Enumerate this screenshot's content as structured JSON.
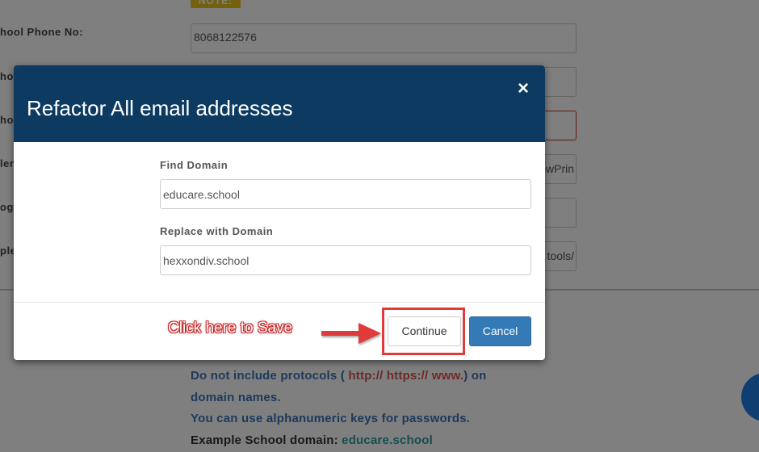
{
  "background": {
    "note_badge": "NOTE:",
    "labels": [
      "hool Phone No:",
      "ho",
      "ho",
      "len",
      "og",
      "ple"
    ],
    "phone_value": "8068122576",
    "partial_fields": [
      "owPrin",
      "tools/"
    ],
    "notes": {
      "line1_prefix": "Do not include protocols (",
      "line1_protocols": " http:// https:// www.",
      "line1_suffix": ") on",
      "line2": "domain names.",
      "line3": "You can use alphanumeric keys for passwords.",
      "line4_prefix": "Example School domain:",
      "line4_domain": "educare.school"
    }
  },
  "modal": {
    "title": "Refactor All email addresses",
    "close_glyph": "×",
    "find_label": "Find Domain",
    "find_value": "educare.school",
    "replace_label": "Replace with Domain",
    "replace_value": "hexxondiv.school",
    "continue_label": "Continue",
    "cancel_label": "Cancel"
  },
  "annotation": {
    "text": "Click here to Save",
    "color": "#e03a3a"
  },
  "colors": {
    "header": "#0c3a60",
    "primary_button": "#337ab7",
    "note_blue": "#3b73b9",
    "note_red": "#d9534f",
    "note_teal": "#2a9a9f"
  }
}
